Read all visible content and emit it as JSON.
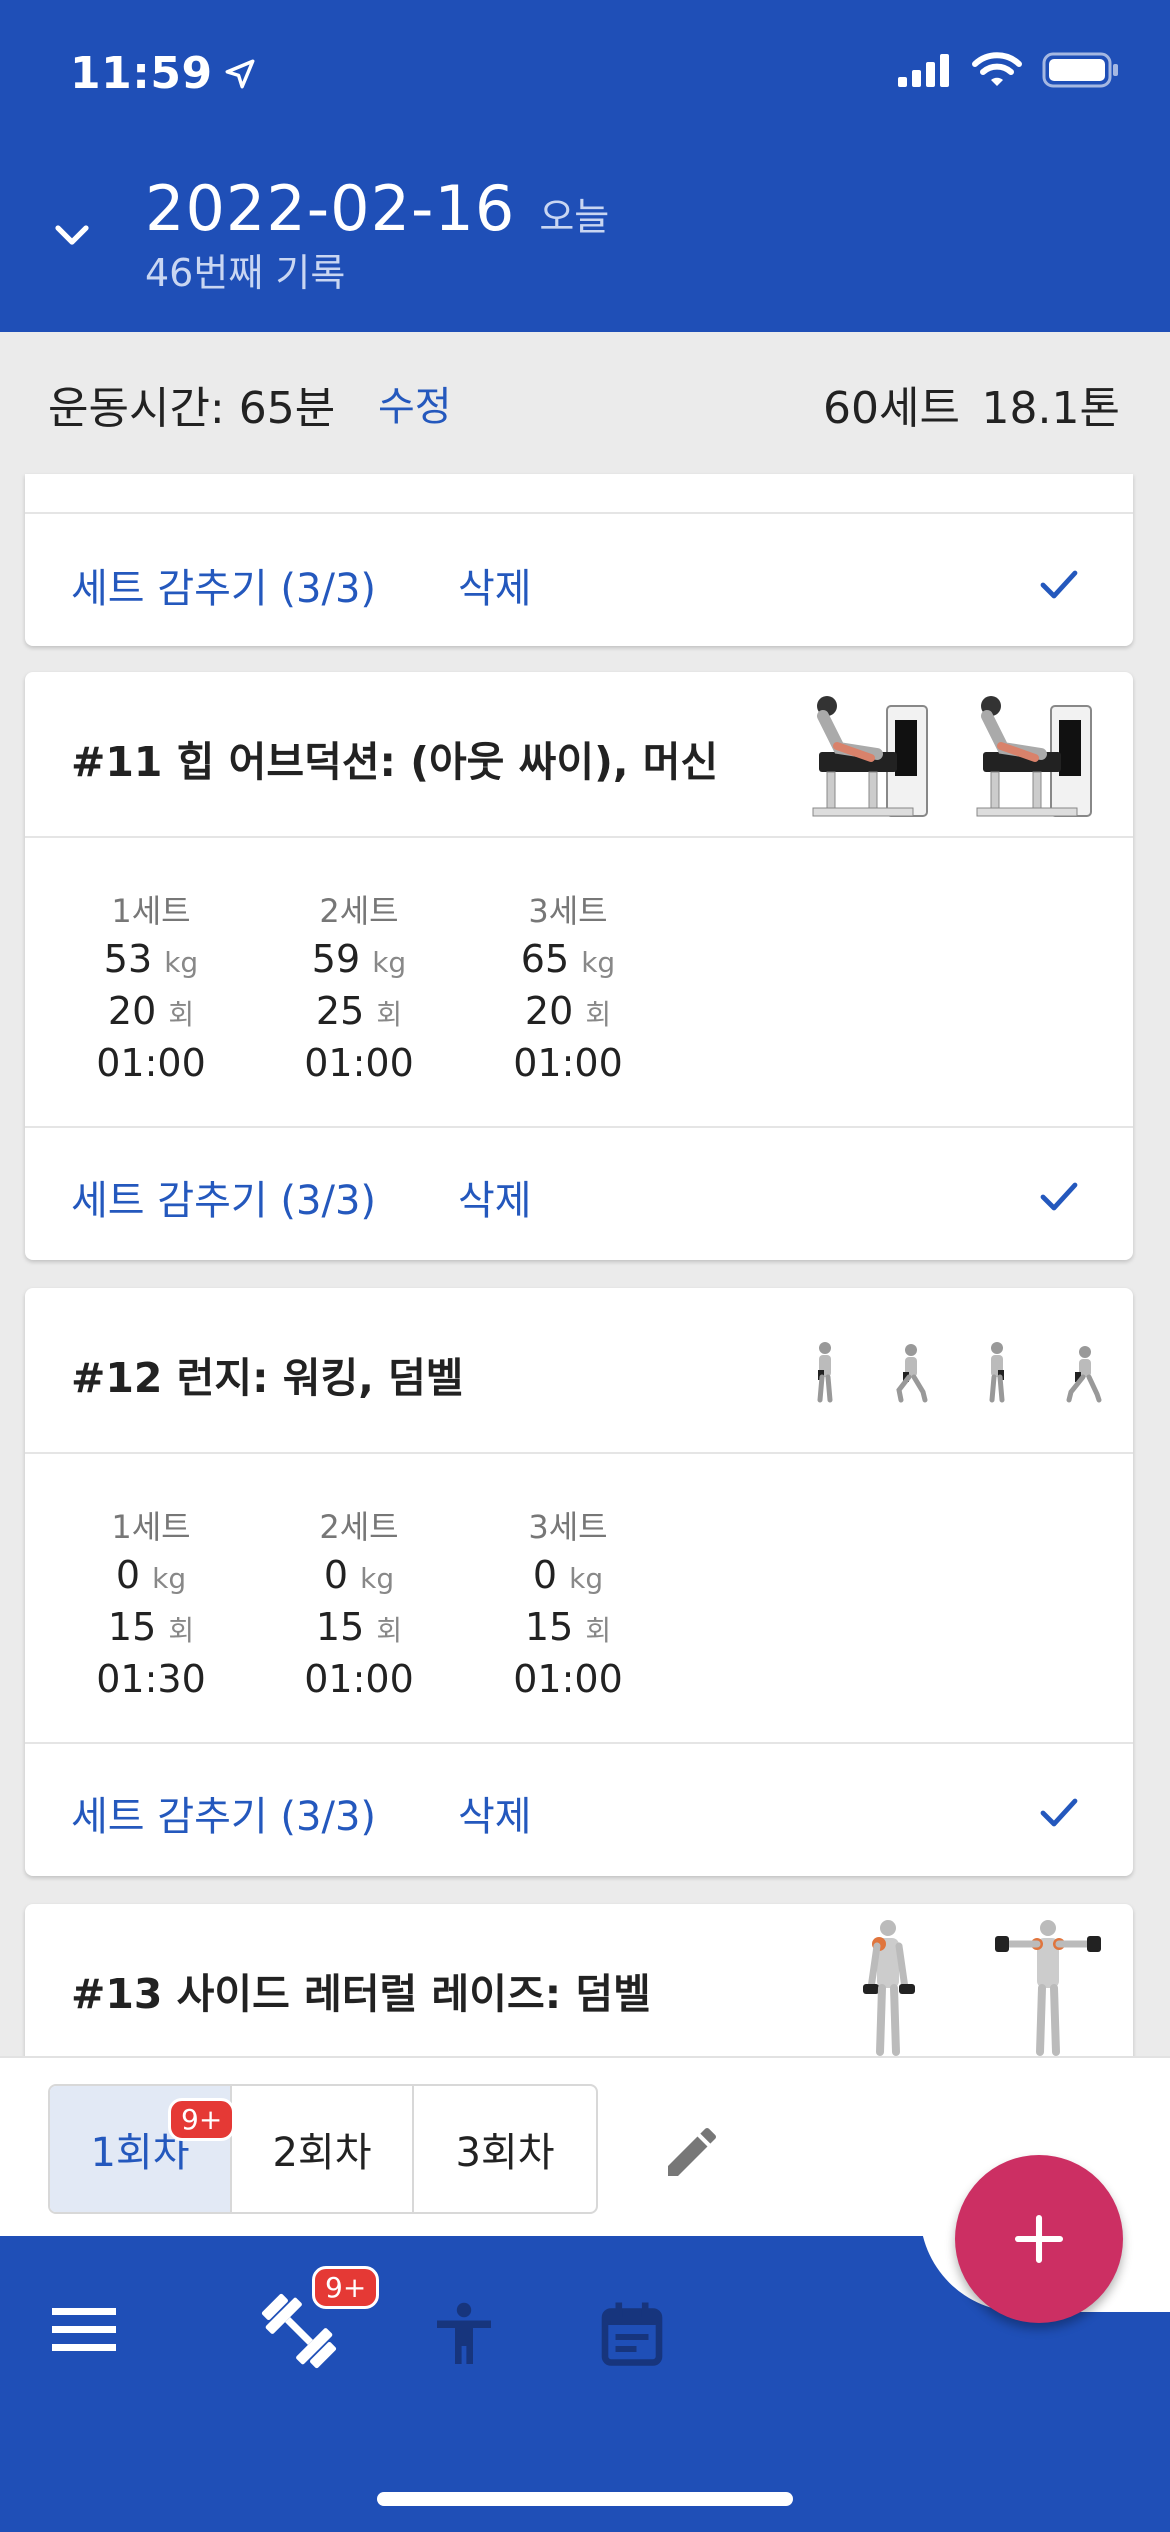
{
  "status_bar": {
    "time": "11:59"
  },
  "header": {
    "date": "2022-02-16",
    "today": "오늘",
    "subtitle": "46번째 기록"
  },
  "summary": {
    "time": "운동시간: 65분",
    "edit": "수정",
    "sets": "60세트",
    "tons": "18.1톤"
  },
  "prev_card": {
    "hide": "세트 감추기 (3/3)",
    "delete": "삭제"
  },
  "exercises": [
    {
      "title": "#11 힙 어브덕션: (아웃 싸이), 머신",
      "hide": "세트 감추기 (3/3)",
      "delete": "삭제",
      "sets": [
        {
          "label": "1세트",
          "weight": "53",
          "kg": "kg",
          "reps": "20",
          "rep_unit": "회",
          "time": "01:00"
        },
        {
          "label": "2세트",
          "weight": "59",
          "kg": "kg",
          "reps": "25",
          "rep_unit": "회",
          "time": "01:00"
        },
        {
          "label": "3세트",
          "weight": "65",
          "kg": "kg",
          "reps": "20",
          "rep_unit": "회",
          "time": "01:00"
        }
      ]
    },
    {
      "title": "#12 런지: 워킹, 덤벨",
      "hide": "세트 감추기 (3/3)",
      "delete": "삭제",
      "sets": [
        {
          "label": "1세트",
          "weight": "0",
          "kg": "kg",
          "reps": "15",
          "rep_unit": "회",
          "time": "01:30"
        },
        {
          "label": "2세트",
          "weight": "0",
          "kg": "kg",
          "reps": "15",
          "rep_unit": "회",
          "time": "01:00"
        },
        {
          "label": "3세트",
          "weight": "0",
          "kg": "kg",
          "reps": "15",
          "rep_unit": "회",
          "time": "01:00"
        }
      ]
    },
    {
      "title": "#13 사이드 레터럴 레이즈: 덤벨"
    }
  ],
  "rounds": {
    "r1": "1회차",
    "r2": "2회차",
    "r3": "3회차",
    "badge": "9+"
  },
  "nav": {
    "badge": "9+"
  },
  "colors": {
    "primary": "#1f4fb7",
    "accent": "#2458bd",
    "fab": "#cc2f63",
    "badge": "#e53935"
  }
}
